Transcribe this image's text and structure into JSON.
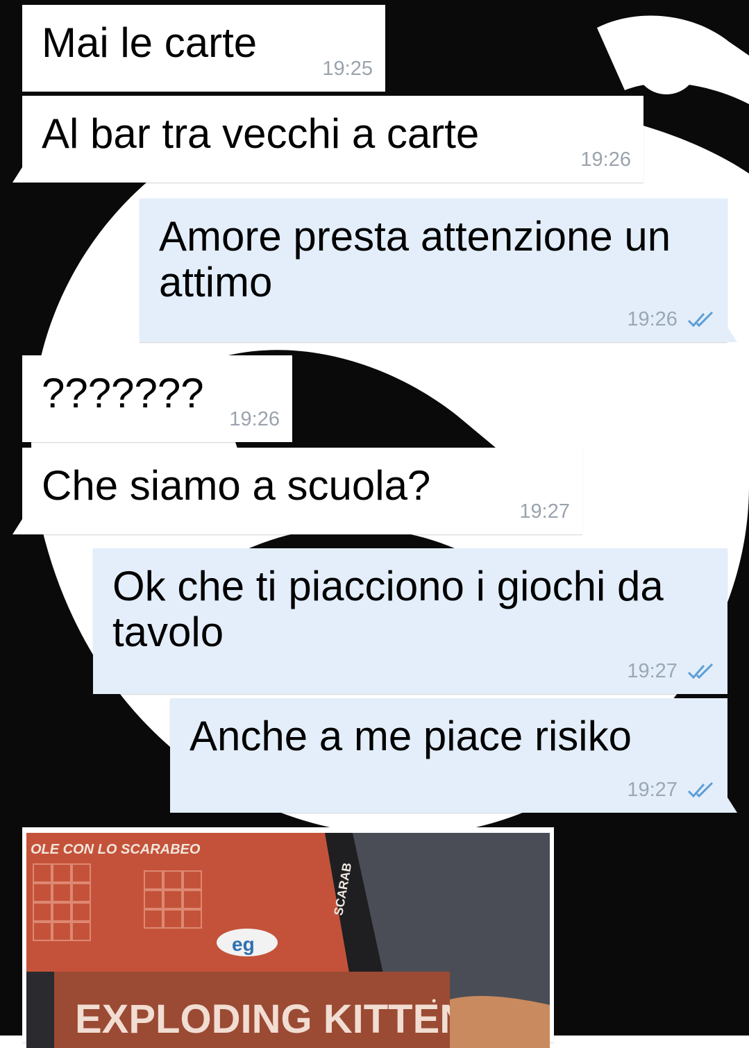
{
  "messages": [
    {
      "direction": "in",
      "text": "Mai le carte",
      "time": "19:25"
    },
    {
      "direction": "in",
      "text": "Al bar tra vecchi a carte",
      "time": "19:26"
    },
    {
      "direction": "out",
      "text": "Amore presta attenzione un attimo",
      "time": "19:26",
      "status": "read-double-check"
    },
    {
      "direction": "in",
      "text": "???????",
      "time": "19:26"
    },
    {
      "direction": "in",
      "text": "Che siamo a scuola?",
      "time": "19:27"
    },
    {
      "direction": "out",
      "text": "Ok che ti piacciono i giochi da tavolo",
      "time": "19:27",
      "status": "read-double-check"
    },
    {
      "direction": "out",
      "text": "Anche a me piace risiko",
      "time": "19:27",
      "status": "read-double-check"
    }
  ],
  "photo": {
    "box_top_text": "OLE CON LO SCARABEO",
    "box_side_text": "SCARAB",
    "logo_text": "eg",
    "kittens_text": "EXPLODING KITTENS",
    "trademark": "•"
  },
  "colors": {
    "incoming_bubble": "#ffffff",
    "outgoing_bubble": "#e3eefa",
    "timestamp": "#9aa3ad",
    "ticks": "#5d9ed6"
  },
  "icons": [
    "double-check-icon"
  ]
}
